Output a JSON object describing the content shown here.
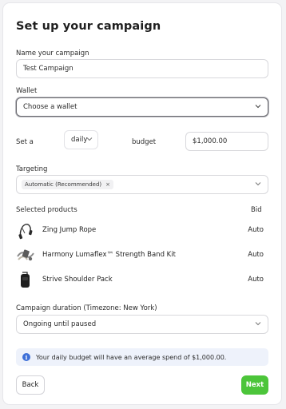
{
  "title": "Set up your campaign",
  "name": {
    "label": "Name your campaign",
    "value": "Test Campaign"
  },
  "wallet": {
    "label": "Wallet",
    "value": "Choose a wallet"
  },
  "budget": {
    "prefix": "Set a",
    "period": "daily",
    "middle": "budget",
    "amount": "$1,000.00"
  },
  "targeting": {
    "label": "Targeting",
    "chip": "Automatic (Recommended)",
    "chip_remove": "×"
  },
  "products": {
    "label": "Selected products",
    "bid_header": "Bid",
    "items": [
      {
        "name": "Zing Jump Rope",
        "bid": "Auto",
        "icon": "jump-rope"
      },
      {
        "name": "Harmony Lumaflex™ Strength Band Kit",
        "bid": "Auto",
        "icon": "band-kit"
      },
      {
        "name": "Strive Shoulder Pack",
        "bid": "Auto",
        "icon": "shoulder-pack"
      }
    ]
  },
  "duration": {
    "label": "Campaign duration (Timezone: New York)",
    "value": "Ongoing until paused"
  },
  "info": {
    "icon": "i",
    "text": "Your daily budget will have an average spend of $1,000.00."
  },
  "buttons": {
    "back": "Back",
    "next": "Next"
  },
  "colors": {
    "accent": "#4cc53a",
    "info_bg": "#eef2fb",
    "info_icon": "#3d6fd8"
  }
}
